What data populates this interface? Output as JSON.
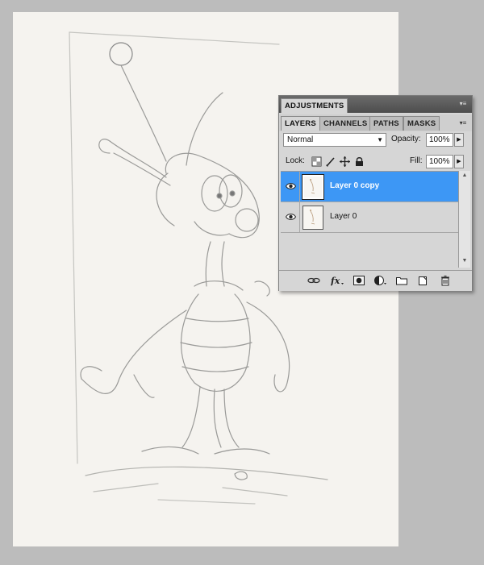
{
  "panel": {
    "top_tabs": [
      {
        "label": "ADJUSTMENTS",
        "active": true
      }
    ],
    "tabs": [
      {
        "label": "LAYERS",
        "active": true
      },
      {
        "label": "CHANNELS",
        "active": false
      },
      {
        "label": "PATHS",
        "active": false
      },
      {
        "label": "MASKS",
        "active": false
      }
    ],
    "blend_mode": "Normal",
    "opacity_label": "Opacity:",
    "opacity_value": "100%",
    "lock_label": "Lock:",
    "fill_label": "Fill:",
    "fill_value": "100%",
    "lock_icons": [
      "lock-transparency-icon",
      "lock-brush-icon",
      "lock-move-icon",
      "lock-all-icon"
    ],
    "layers": [
      {
        "name": "Layer 0 copy",
        "visible": true,
        "selected": true
      },
      {
        "name": "Layer 0",
        "visible": true,
        "selected": false
      }
    ],
    "bottom_icons": [
      "link-layers-icon",
      "fx-icon",
      "add-mask-icon",
      "adjustment-layer-icon",
      "new-group-icon",
      "new-layer-icon",
      "trash-icon"
    ],
    "colors": {
      "selected_row": "#3d97f5",
      "panel_bg": "#d6d6d6",
      "tab_bar": "#5a5a5a"
    }
  }
}
